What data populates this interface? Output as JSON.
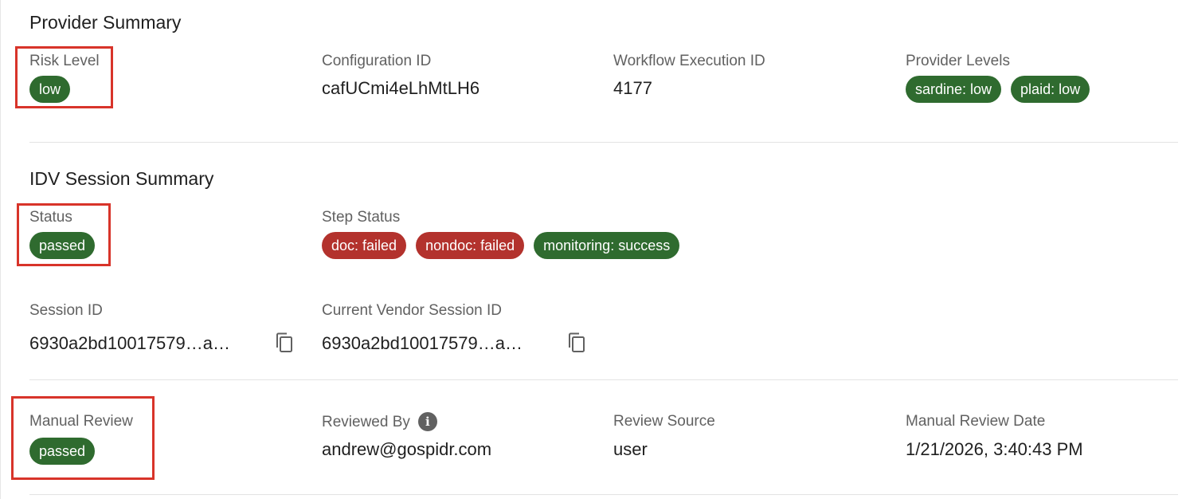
{
  "provider_summary": {
    "title": "Provider Summary",
    "risk_level": {
      "label": "Risk Level",
      "value": "low"
    },
    "configuration_id": {
      "label": "Configuration ID",
      "value": "cafUCmi4eLhMtLH6"
    },
    "workflow_execution_id": {
      "label": "Workflow Execution ID",
      "value": "4177"
    },
    "provider_levels": {
      "label": "Provider Levels",
      "items": [
        "sardine: low",
        "plaid: low"
      ]
    }
  },
  "idv_session_summary": {
    "title": "IDV Session Summary",
    "status": {
      "label": "Status",
      "value": "passed"
    },
    "step_status": {
      "label": "Step Status",
      "items": [
        "doc: failed",
        "nondoc: failed",
        "monitoring: success"
      ]
    },
    "session_id": {
      "label": "Session ID",
      "value": "6930a2bd10017579…a…",
      "icon": "copy-icon"
    },
    "current_vendor_session_id": {
      "label": "Current Vendor Session ID",
      "value": "6930a2bd10017579…a…",
      "icon": "copy-icon"
    }
  },
  "manual_review": {
    "manual_review": {
      "label": "Manual Review",
      "value": "passed"
    },
    "reviewed_by": {
      "label": "Reviewed By",
      "value": "andrew@gospidr.com",
      "icon": "info-icon"
    },
    "review_source": {
      "label": "Review Source",
      "value": "user"
    },
    "manual_review_date": {
      "label": "Manual Review Date",
      "value": "1/21/2026, 3:40:43 PM"
    }
  },
  "colors": {
    "success_chip": "#2f6b2f",
    "failed_chip": "#b3322d",
    "highlight_box": "#d8342a",
    "label_text": "#616161"
  }
}
